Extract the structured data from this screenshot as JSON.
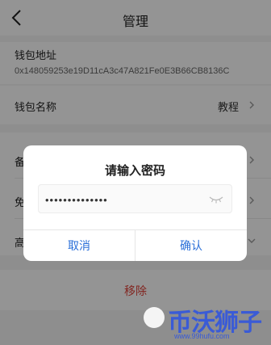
{
  "nav": {
    "title": "管理"
  },
  "wallet": {
    "address_label": "钱包地址",
    "address_value": "0x148059253e19D11cA3c47A821Fe0E3B66CB8136C",
    "name_label": "钱包名称",
    "name_value": "教程"
  },
  "rows": [
    {
      "label": "备"
    },
    {
      "label": "免"
    },
    {
      "label": "高"
    }
  ],
  "remove_label": "移除",
  "dialog": {
    "title": "请输入密码",
    "password_value": "••••••••••••••",
    "cancel_label": "取消",
    "confirm_label": "确认"
  },
  "watermark": {
    "text": "币沃狮子",
    "url": "www.99hufu.com"
  },
  "colors": {
    "accent": "#2a6fd8",
    "danger": "#e0433a"
  }
}
